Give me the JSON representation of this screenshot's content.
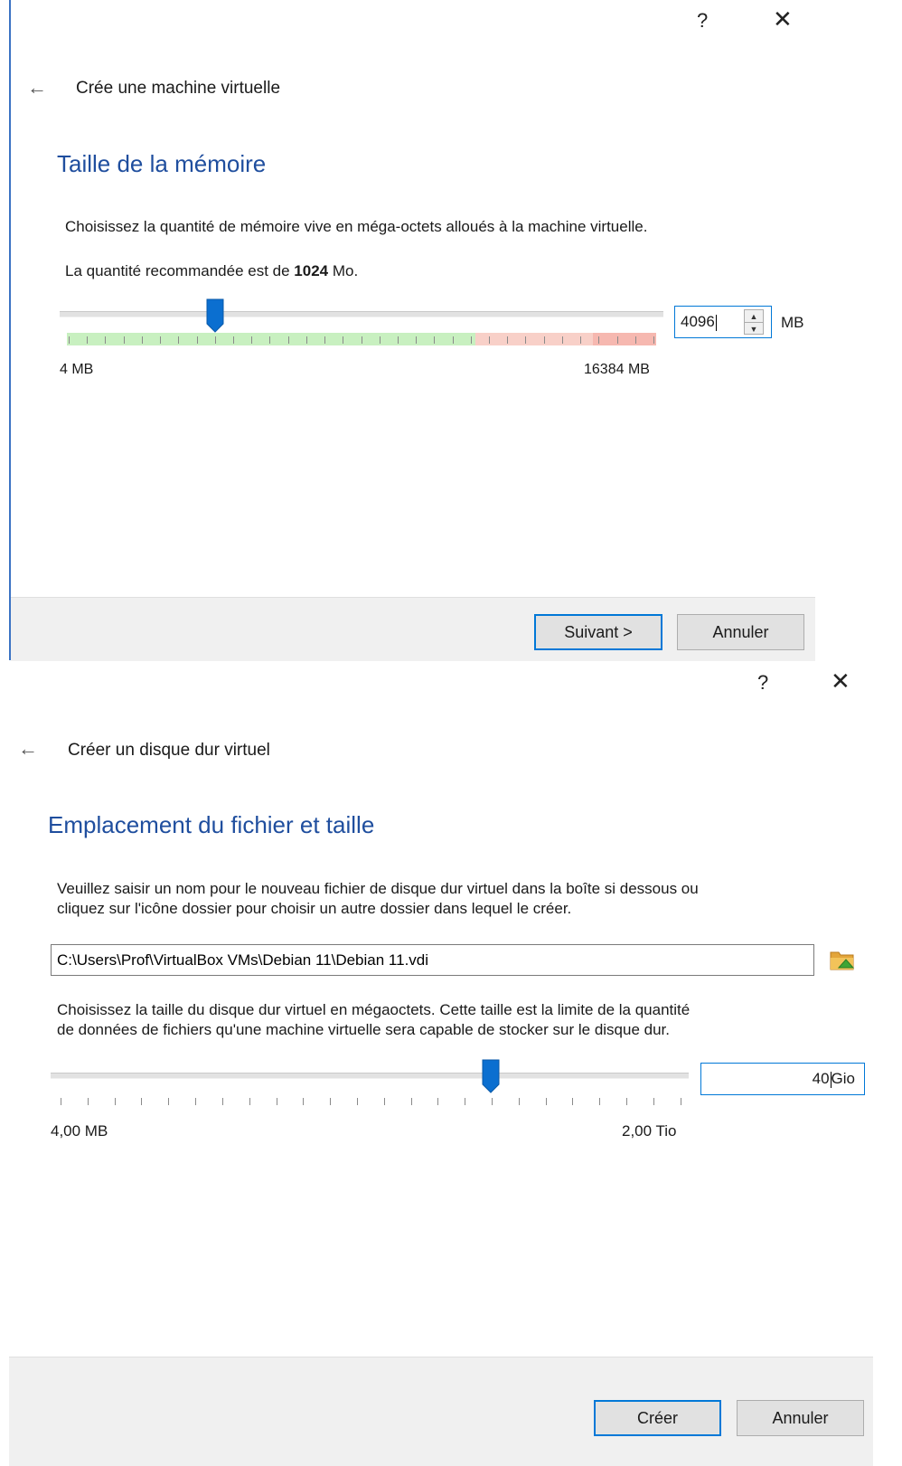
{
  "dialog1": {
    "help_glyph": "?",
    "close_glyph": "✕",
    "back_glyph": "←",
    "window_title": "Crée une machine virtuelle",
    "heading": "Taille de la mémoire",
    "description": "Choisissez la quantité de mémoire vive en méga-octets alloués à la machine virtuelle.",
    "recommend_prefix": "La quantité recommandée est de",
    "recommend_value": "1024",
    "recommend_suffix": "Mo.",
    "slider": {
      "value_mb": 4096,
      "min_label": "4 MB",
      "max_label": "16384 MB"
    },
    "memory_value": "4096",
    "memory_unit": "MB",
    "next_button": "Suivant >",
    "cancel_button": "Annuler"
  },
  "dialog2": {
    "help_glyph": "?",
    "close_glyph": "✕",
    "back_glyph": "←",
    "window_title": "Créer un disque dur virtuel",
    "heading": "Emplacement du fichier et taille",
    "description_line1": "Veuillez saisir un nom pour le nouveau fichier de disque dur virtuel dans la boîte si dessous ou",
    "description_line2": "cliquez sur l'icône dossier pour choisir un autre dossier dans lequel le créer.",
    "file_path": "C:\\Users\\Prof\\VirtualBox VMs\\Debian 11\\Debian 11.vdi",
    "size_description_line1": "Choisissez la taille du disque dur virtuel en mégaoctets. Cette taille est la limite de la quantité",
    "size_description_line2": "de données de fichiers qu'une machine virtuelle sera capable de stocker sur le disque dur.",
    "slider": {
      "min_label": "4,00 MB",
      "max_label": "2,00 Tio"
    },
    "size_value": "40",
    "size_unit": "Gio",
    "create_button": "Créer",
    "cancel_button": "Annuler"
  },
  "colors": {
    "heading": "#1f4e9e",
    "accent": "#0078d7",
    "slider_green": "#c8f0c0",
    "slider_red": "#f8c8c0"
  }
}
